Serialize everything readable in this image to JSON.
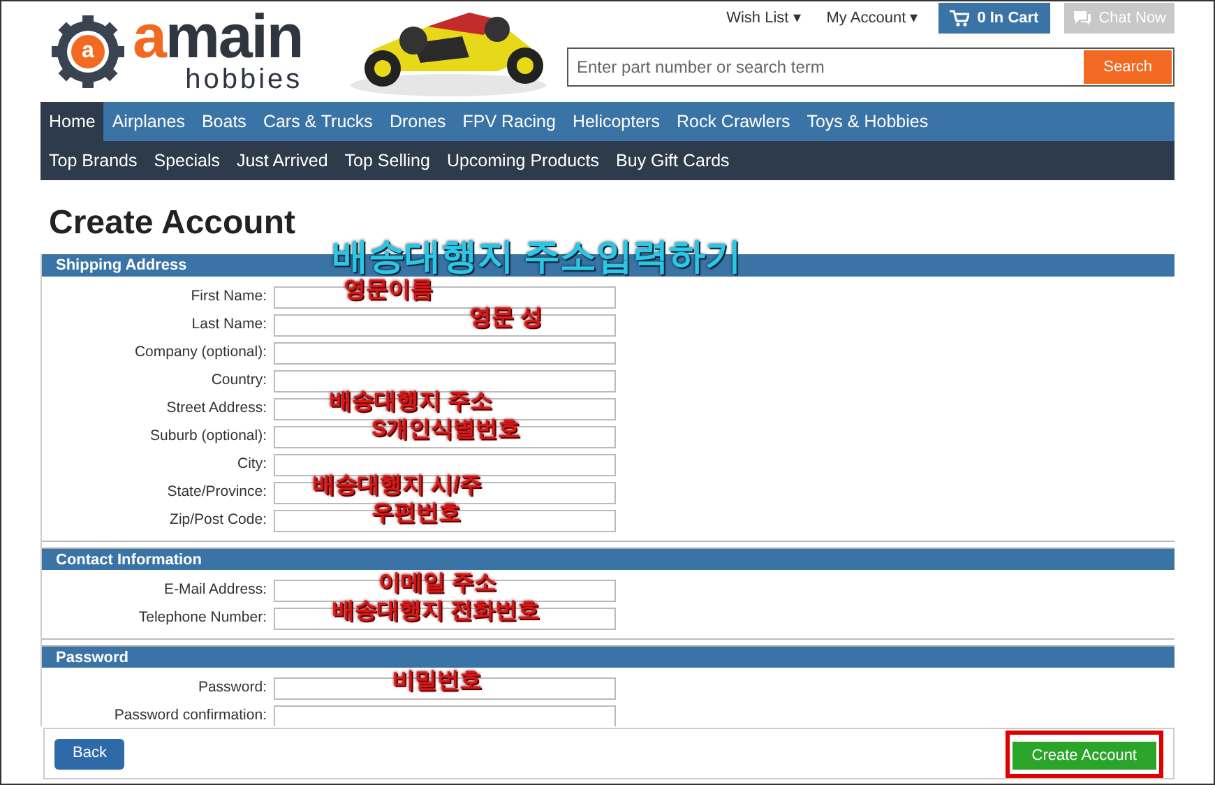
{
  "logo": {
    "badge": "a",
    "accent": "a",
    "rest": "main",
    "sub": "hobbies"
  },
  "top_links": [
    {
      "label": "Wish List",
      "caret": "▾"
    },
    {
      "label": "My Account",
      "caret": "▾"
    }
  ],
  "cart": {
    "count": "0",
    "label": "In Cart"
  },
  "chat": {
    "label": "Chat Now"
  },
  "search": {
    "placeholder": "Enter part number or search term",
    "button": "Search"
  },
  "nav_primary": [
    {
      "label": "Home",
      "selected": true
    },
    {
      "label": "Airplanes",
      "selected": false
    },
    {
      "label": "Boats",
      "selected": false
    },
    {
      "label": "Cars & Trucks",
      "selected": false
    },
    {
      "label": "Drones",
      "selected": false
    },
    {
      "label": "FPV Racing",
      "selected": false
    },
    {
      "label": "Helicopters",
      "selected": false
    },
    {
      "label": "Rock Crawlers",
      "selected": false
    },
    {
      "label": "Toys & Hobbies",
      "selected": false
    }
  ],
  "nav_secondary": [
    "Top Brands",
    "Specials",
    "Just Arrived",
    "Top Selling",
    "Upcoming Products",
    "Buy Gift Cards"
  ],
  "page_title": "Create Account",
  "title_annotation": "배송대행지 주소입력하기",
  "sections": [
    {
      "title": "Shipping Address",
      "fields": [
        {
          "label": "First Name:",
          "annotation": "영문이름"
        },
        {
          "label": "Last Name:",
          "annotation": "영문 성"
        },
        {
          "label": "Company (optional):"
        },
        {
          "label": "Country:"
        },
        {
          "label": "Street Address:",
          "annotation": "배송대행지 주소"
        },
        {
          "label": "Suburb (optional):",
          "annotation": "S개인식별번호"
        },
        {
          "label": "City:"
        },
        {
          "label": "State/Province:",
          "annotation": "배송대행지 시/주"
        },
        {
          "label": "Zip/Post Code:",
          "annotation": "우편번호"
        }
      ]
    },
    {
      "title": "Contact Information",
      "fields": [
        {
          "label": "E-Mail Address:",
          "annotation": "이메일 주소"
        },
        {
          "label": "Telephone Number:",
          "annotation": "배송대행지 전화번호"
        }
      ]
    },
    {
      "title": "Password",
      "fields": [
        {
          "label": "Password:",
          "annotation": "비밀번호"
        },
        {
          "label": "Password confirmation:"
        }
      ]
    }
  ],
  "footer": {
    "back": "Back",
    "submit": "Create Account",
    "submit_highlighted": true
  }
}
